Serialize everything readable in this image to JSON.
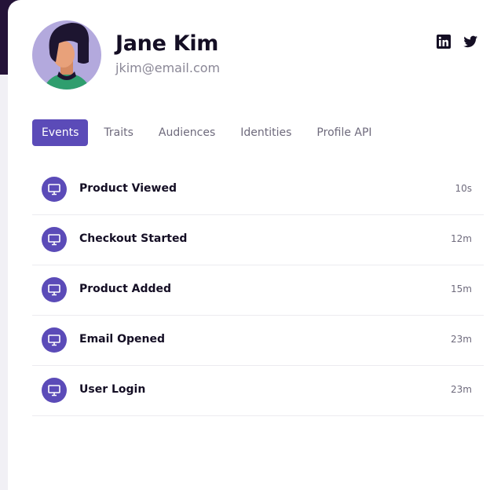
{
  "profile": {
    "name": "Jane Kim",
    "email": "jkim@email.com",
    "avatar_icon": "user-avatar-illustration",
    "social": [
      {
        "icon": "linkedin-icon"
      },
      {
        "icon": "twitter-icon"
      }
    ]
  },
  "tabs": [
    {
      "label": "Events",
      "active": true
    },
    {
      "label": "Traits",
      "active": false
    },
    {
      "label": "Audiences",
      "active": false
    },
    {
      "label": "Identities",
      "active": false
    },
    {
      "label": "Profile API",
      "active": false
    }
  ],
  "events": [
    {
      "name": "Product Viewed",
      "time": "10s",
      "icon": "monitor-icon"
    },
    {
      "name": "Checkout Started",
      "time": "12m",
      "icon": "monitor-icon"
    },
    {
      "name": "Product Added",
      "time": "15m",
      "icon": "monitor-icon"
    },
    {
      "name": "Email Opened",
      "time": "23m",
      "icon": "monitor-icon"
    },
    {
      "name": "User Login",
      "time": "23m",
      "icon": "monitor-icon"
    }
  ],
  "colors": {
    "accent": "#5b4bb8",
    "heading": "#140e24",
    "muted": "#6e6a7c",
    "avatar_bg": "#b3a9dd",
    "dark_corner": "#241338"
  }
}
